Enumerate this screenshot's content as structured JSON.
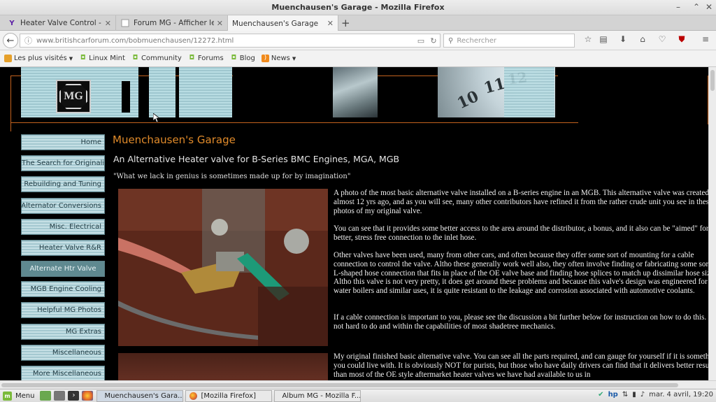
{
  "window": {
    "title": "Muenchausen's Garage - Mozilla Firefox"
  },
  "tabs": [
    {
      "label": "Heater Valve Control - Ya...",
      "favicon": "Y"
    },
    {
      "label": "Forum MG - Afficher le sujet -...",
      "favicon": ""
    },
    {
      "label": "Muenchausen's Garage",
      "favicon": ""
    }
  ],
  "navbar": {
    "url": "www.britishcarforum.com/bobmuenchausen/12272.html",
    "search_placeholder": "Rechercher"
  },
  "bookmarks": [
    {
      "label": "Les plus visités",
      "dropdown": true
    },
    {
      "label": "Linux Mint",
      "dropdown": false
    },
    {
      "label": "Community",
      "dropdown": false
    },
    {
      "label": "Forums",
      "dropdown": false
    },
    {
      "label": "Blog",
      "dropdown": false
    },
    {
      "label": "News",
      "dropdown": true
    }
  ],
  "page": {
    "logo_text": "MG",
    "site_title": "Muenchausen's Garage",
    "article_title": "An Alternative Heater valve for B-Series BMC Engines, MGA, MGB",
    "quote": "\"What we lack in genius is sometimes made up for by imagination\"",
    "nav_items": [
      "Home",
      "The Search for Originality",
      "Rebuilding and Tuning",
      "Alternator Conversions",
      "Misc. Electrical",
      "Heater Valve R&R",
      "Alternate Htr Valve",
      "MGB Engine Cooling",
      "Helpful MG Photos",
      "MG Extras",
      "Miscellaneous",
      "More Miscellaneous"
    ],
    "active_nav": "Alternate Htr Valve",
    "paragraphs": [
      "A photo of the most basic alternative valve installed on a B-series engine in an MGB. This alternative valve was created almost 12 yrs ago, and as you will see, many other contributors have refined it from the rather crude unit you see in these photos of my original valve.",
      "You can see that it provides some better access to the area around the distributor, a bonus, and it also can be \"aimed\" for a better, stress free connection to the inlet hose.",
      "Other valves have been used, many from other cars, and often because they offer some sort of mounting for a cable connection to control the valve. Altho these generally work well also, they often involve finding or fabricating some sort of L-shaped hose connection that fits in place of the OE valve base and finding hose splices to match up dissimilar hose sizes. Altho this valve is not very pretty, it does get around these problems and because this valve's design was engineered for hot water boilers and similar uses, it is quite resistant to the leakage and corrosion associated with automotive coolants.",
      "If a cable connection is important to you, please see the discussion a bit further below for instruction on how to do this.  It is not hard to do and within the capabilities of most shadetree mechanics.",
      "My original finished basic alternative valve. You can see all the parts required, and can gauge for yourself if it is something you could live with. It is obviously NOT for purists, but those who have daily drivers can find that it delivers better results than most of the OE style aftermarket heater valves we have had available to us in"
    ],
    "clock_numbers": [
      "10",
      "11",
      "12"
    ]
  },
  "taskbar": {
    "menu_label": "Menu",
    "tasks": [
      {
        "label": "Muenchausen's Gara...",
        "active": true
      },
      {
        "label": "[Mozilla Firefox]",
        "active": false
      },
      {
        "label": "Album MG - Mozilla F...",
        "active": false
      }
    ],
    "clock": "mar. 4 avril, 19:20"
  },
  "colors": {
    "accent_orange": "#e08a2a",
    "nav_blue": "#a4c8d0",
    "nav_active": "#5f8990"
  }
}
